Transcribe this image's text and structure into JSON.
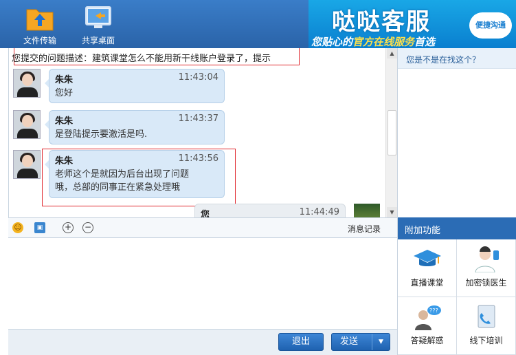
{
  "toolbar": {
    "file_transfer": "文件传输",
    "share_desktop": "共享桌面"
  },
  "banner": {
    "title": "哒哒客服",
    "slogan_a": "您贴心的",
    "slogan_b": "官方在线服务",
    "slogan_c": "首选",
    "cloud": "便捷沟通"
  },
  "chat": {
    "problem": "您提交的问题描述：建筑课堂怎么不能用新干线账户登录了，提示",
    "messages": [
      {
        "name": "朱朱",
        "time": "11:43:04",
        "lines": [
          "您好"
        ]
      },
      {
        "name": "朱朱",
        "time": "11:43:37",
        "lines": [
          "是登陆提示要激活是吗."
        ]
      },
      {
        "name": "朱朱",
        "time": "11:43:56",
        "lines": [
          "老师这个是就因为后台出现了问题",
          "哦，总部的同事正在紧急处理哦"
        ]
      }
    ],
    "partial": {
      "name": "您",
      "time": "11:44:49"
    }
  },
  "suggest": {
    "title": "您是不是在找这个？"
  },
  "input_bar": {
    "history": "消息记录"
  },
  "buttons": {
    "exit": "退出",
    "send": "发送"
  },
  "extra": {
    "title": "附加功能",
    "items": [
      {
        "label": "直播课堂"
      },
      {
        "label": "加密锁医生"
      },
      {
        "label": "答疑解惑"
      },
      {
        "label": "线下培训"
      }
    ]
  },
  "colors": {
    "brand": "#2b6cb5",
    "bubble": "#d9e9f8",
    "highlight": "#e0282e"
  }
}
